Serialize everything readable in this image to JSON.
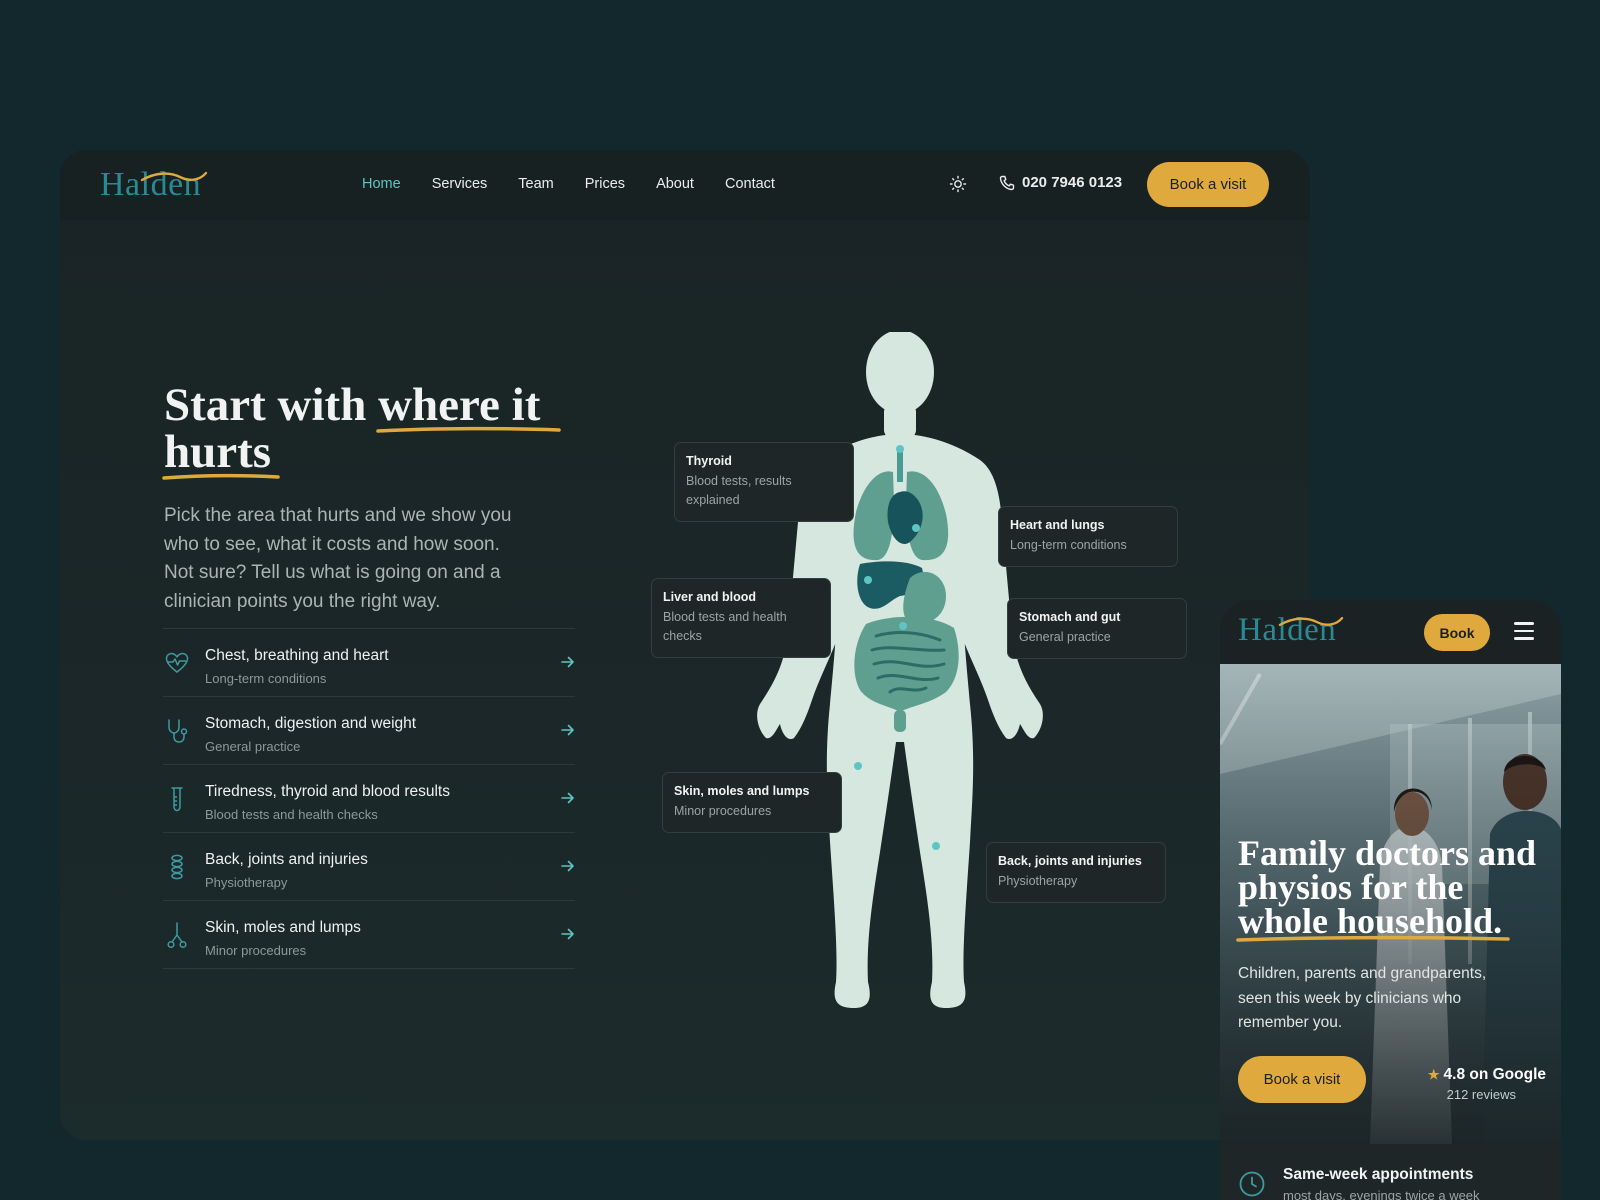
{
  "brand": {
    "name": "Halden"
  },
  "nav": {
    "items": [
      {
        "label": "Home",
        "active": true
      },
      {
        "label": "Services"
      },
      {
        "label": "Team"
      },
      {
        "label": "Prices"
      },
      {
        "label": "About"
      },
      {
        "label": "Contact"
      }
    ],
    "phone": "020 7946 0123",
    "cta": "Book a visit"
  },
  "hero": {
    "title_a": "Start with ",
    "title_b": "where it",
    "title_c": "hurts",
    "subtitle": "Pick the area that hurts and we show you who to see, what it costs and how soon. Not sure? Tell us what is going on and a clinician points you the right way."
  },
  "categories": [
    {
      "title": "Chest, breathing and heart",
      "sub": "Long-term conditions",
      "icon": "heart-pulse-icon"
    },
    {
      "title": "Stomach, digestion and weight",
      "sub": "General practice",
      "icon": "stethoscope-icon"
    },
    {
      "title": "Tiredness, thyroid and blood results",
      "sub": "Blood tests and health checks",
      "icon": "test-tube-icon"
    },
    {
      "title": "Back, joints and injuries",
      "sub": "Physiotherapy",
      "icon": "spine-icon"
    },
    {
      "title": "Skin, moles and lumps",
      "sub": "Minor procedures",
      "icon": "scissors-icon"
    }
  ],
  "body_tags": {
    "thyroid": {
      "title": "Thyroid",
      "sub": "Blood tests, results explained"
    },
    "heart": {
      "title": "Heart and lungs",
      "sub": "Long-term conditions"
    },
    "liver": {
      "title": "Liver and blood",
      "sub": "Blood tests and health checks"
    },
    "stomach": {
      "title": "Stomach and gut",
      "sub": "General practice"
    },
    "skin": {
      "title": "Skin, moles and lumps",
      "sub": "Minor procedures"
    },
    "back": {
      "title": "Back, joints and injuries",
      "sub": "Physiotherapy"
    }
  },
  "mobile": {
    "book": "Book",
    "title_a": "Family doctors and physios for the ",
    "title_b": "whole household",
    "title_c": ".",
    "subtitle": "Children, parents and grandparents, seen this week by clinicians who remember you.",
    "cta": "Book a visit",
    "rating": "4.8 on Google",
    "reviews": "212 reviews",
    "feature_title": "Same-week appointments",
    "feature_sub": "most days, evenings twice a week"
  },
  "colors": {
    "accent_gold": "#e0a93d",
    "accent_teal": "#5fc4c4",
    "brand_teal": "#2a8a93",
    "background": "#13282d"
  }
}
